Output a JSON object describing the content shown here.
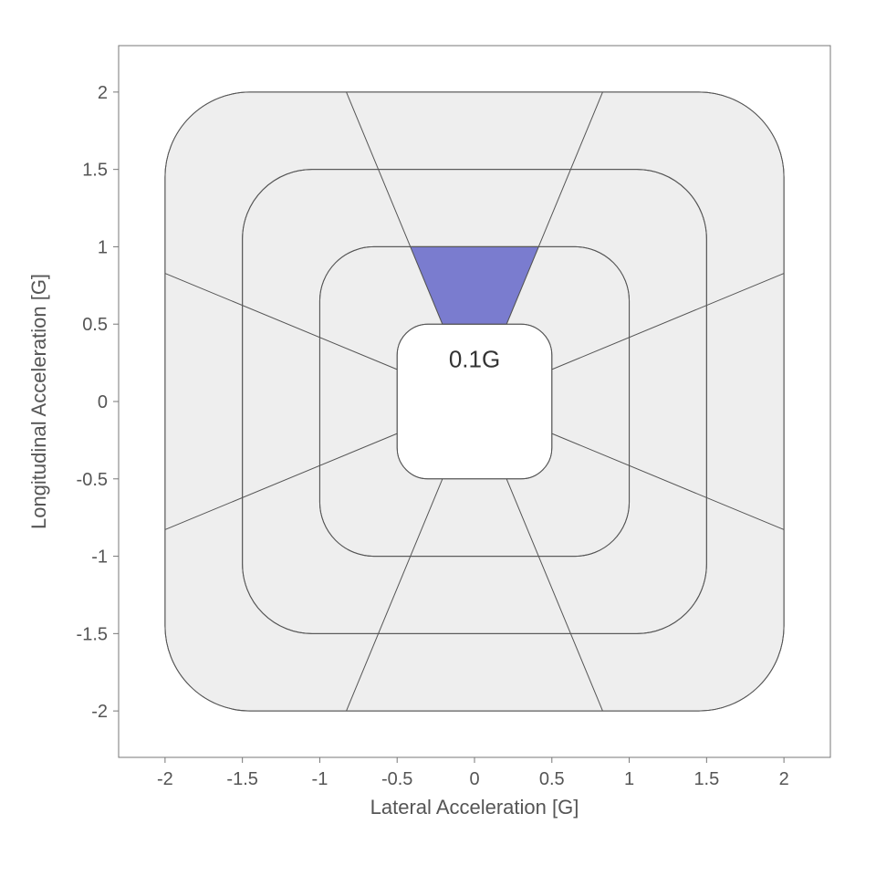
{
  "chart_data": {
    "type": "gg-diagram",
    "xlabel": "Lateral Acceleration [G]",
    "ylabel": "Longitudinal Acceleration [G]",
    "center_label": "0.1G",
    "x_ticks": [
      -2,
      -1.5,
      -1,
      -0.5,
      0,
      0.5,
      1,
      1.5,
      2
    ],
    "y_ticks": [
      -2,
      -1.5,
      -1,
      -0.5,
      0,
      0.5,
      1,
      1.5,
      2
    ],
    "xlim": [
      -2.3,
      2.3
    ],
    "ylim": [
      -2.3,
      2.3
    ],
    "rings_half_side": [
      0.5,
      1.0,
      1.5,
      2.0
    ],
    "ring_corner_radius": [
      0.2,
      0.35,
      0.45,
      0.55
    ],
    "sector_count": 8,
    "sector_angles_deg": [
      67.5,
      112.5,
      157.5,
      202.5,
      247.5,
      292.5,
      337.5,
      22.5
    ],
    "highlighted": {
      "sector_deg_range": [
        67.5,
        112.5
      ],
      "ring_range": [
        0.5,
        1.0
      ]
    },
    "colors": {
      "ring_fill": "#eeeeee",
      "ring_stroke": "#555555",
      "highlight_fill": "#7a7ccf",
      "frame_stroke": "#777777"
    }
  }
}
